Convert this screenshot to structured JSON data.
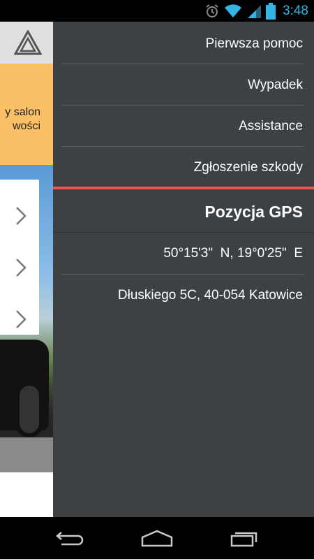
{
  "status_bar": {
    "time": "3:48",
    "icons": [
      "alarm-icon",
      "wifi-icon",
      "signal-icon",
      "battery-icon"
    ],
    "accent_color": "#33b5e5"
  },
  "background_app": {
    "banner_text_line1": "y salon",
    "banner_text_line2": "wości",
    "banner_color": "#fbbf66",
    "header_icon": "warning-triangle-icon"
  },
  "drawer": {
    "menu": [
      {
        "label": "Pierwsza pomoc"
      },
      {
        "label": "Wypadek"
      },
      {
        "label": "Assistance"
      },
      {
        "label": "Zgłoszenie szkody"
      }
    ],
    "accent_color": "#ef5350",
    "gps": {
      "title": "Pozycja GPS",
      "coordinates": "50°15'3\"  N, 19°0'25\"  E",
      "address": "Dłuskiego 5C, 40-054 Katowice"
    }
  },
  "nav_bar": {
    "buttons": [
      "back-icon",
      "home-icon",
      "recent-apps-icon"
    ]
  }
}
